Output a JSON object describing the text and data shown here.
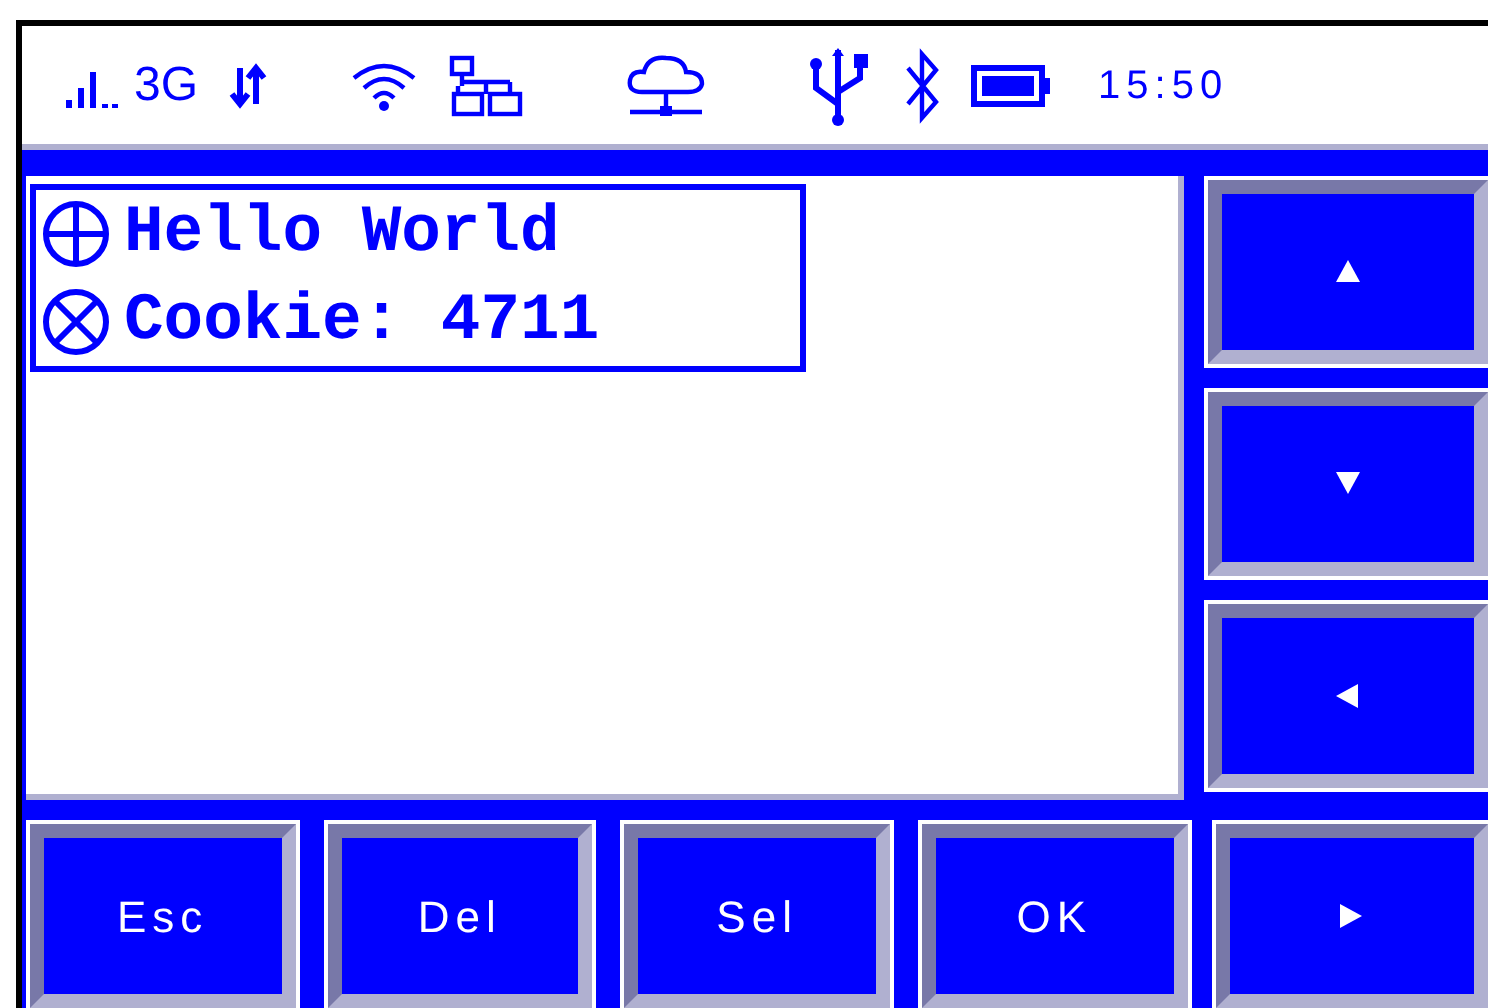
{
  "status_bar": {
    "network_type": "3G",
    "time": "15:50"
  },
  "list": [
    {
      "kind": "plus",
      "text": "Hello World"
    },
    {
      "kind": "cross",
      "text": "Cookie: 4711"
    }
  ],
  "side_buttons": [
    {
      "kind": "up"
    },
    {
      "kind": "down"
    },
    {
      "kind": "left"
    },
    {
      "kind": "right"
    }
  ],
  "bottom_buttons": [
    "Esc",
    "Del",
    "Sel",
    "OK"
  ]
}
